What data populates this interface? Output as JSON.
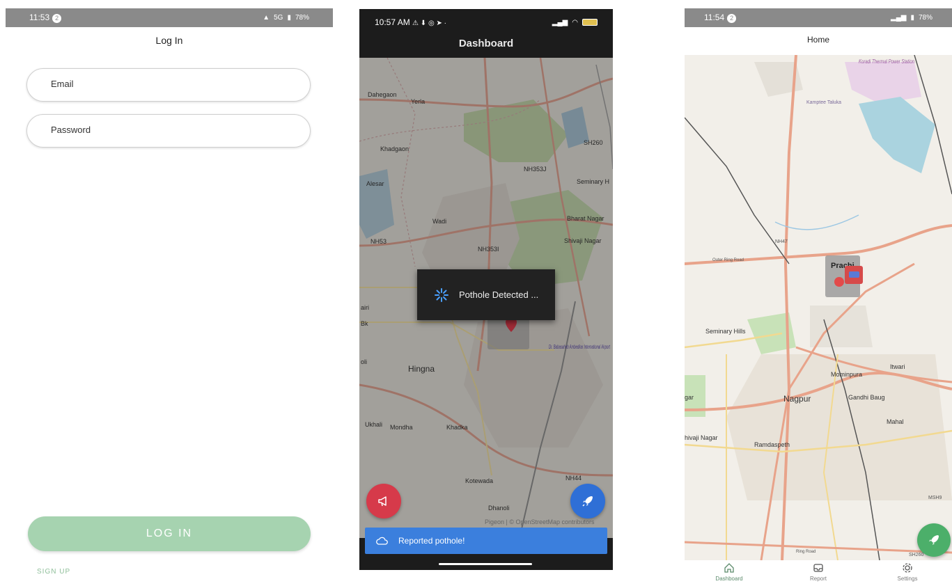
{
  "login": {
    "status": {
      "time": "11:53",
      "badge": "2",
      "right": "5G",
      "battery": "78%"
    },
    "title": "Log In",
    "email_placeholder": "Email",
    "password_placeholder": "Password",
    "login_button": "LOG IN",
    "signup_link": "SIGN UP"
  },
  "dashboard": {
    "status": {
      "time": "10:57 AM"
    },
    "title": "Dashboard",
    "map_labels": [
      "Dahegaon",
      "Yerla",
      "Khadgaon",
      "Alesar",
      "Wadi",
      "NH53",
      "NH353J",
      "NH353I",
      "SH260",
      "Seminary H",
      "Bharat Nagar",
      "Shivaji Nagar",
      "Hingna",
      "Ukhali",
      "Mondha",
      "Khadka",
      "Kotewada",
      "Dhanoli",
      "NH44",
      "Dr. Babasaheb Ambedkar International Airport",
      "airi",
      "Bk",
      "oli"
    ],
    "dialog_text": "Pothole Detected ...",
    "attribution": "Pigeon | © OpenStreetMap contributors",
    "snackbar_text": "Reported pothole!",
    "colors": {
      "report_fab": "#d63a4a",
      "rocket_fab": "#2f6fd6",
      "snackbar": "#3b7fdd"
    }
  },
  "home": {
    "status": {
      "time": "11:54",
      "badge": "2",
      "battery": "78%"
    },
    "title": "Home",
    "map_labels": [
      "Koradi Thermal Power Station",
      "Kamptee Taluka",
      "NH47",
      "Prachi",
      "Seminary Hills",
      "Mominpura",
      "Itwari",
      "Nagpur",
      "Gandhi Baug",
      "Mahal",
      "Ramdaspeth",
      "hivaji Nagar",
      "gar",
      "MSH9",
      "SH260",
      "Ring Road",
      "Outer Ring Road"
    ],
    "nav": [
      {
        "label": "Dashboard",
        "icon": "home-icon"
      },
      {
        "label": "Report",
        "icon": "inbox-icon"
      },
      {
        "label": "Settings",
        "icon": "gear-icon"
      }
    ],
    "colors": {
      "rocket_fab": "#4caf6a"
    }
  }
}
